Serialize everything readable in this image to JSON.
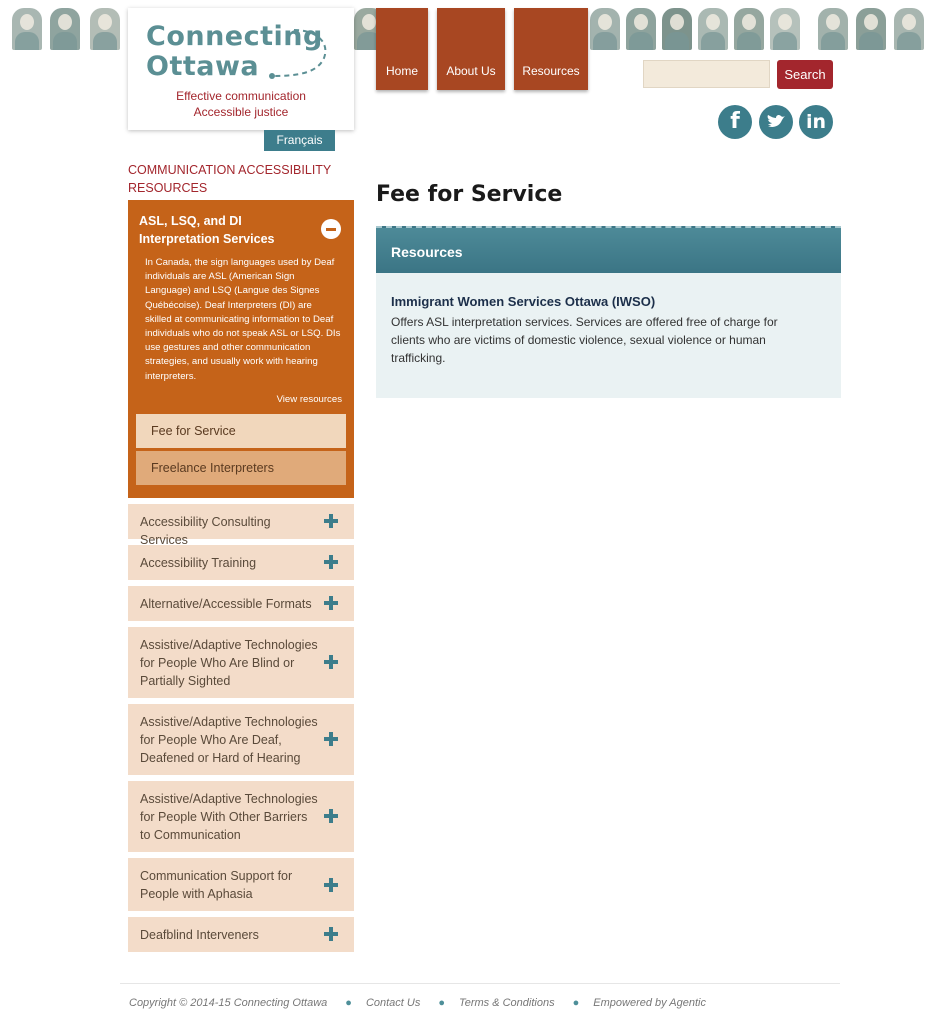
{
  "logo": {
    "title_line1": "Connecting",
    "title_line2": "Ottawa",
    "tagline1": "Effective communication",
    "tagline2": "Accessible justice"
  },
  "lang_toggle": "Français",
  "nav": {
    "home": "Home",
    "about": "About Us",
    "resources": "Resources"
  },
  "search": {
    "placeholder": "",
    "button": "Search"
  },
  "social": {
    "facebook_icon": "facebook-icon",
    "twitter_icon": "twitter-icon",
    "linkedin_icon": "linkedin-icon"
  },
  "sidebar": {
    "heading": "COMMUNICATION ACCESSIBILITY RESOURCES",
    "open_section": {
      "title": "ASL, LSQ, and DI Interpretation Services",
      "description": "In Canada, the sign languages used by Deaf individuals are ASL (American Sign Language) and LSQ (Langue des Signes Québécoise). Deaf Interpreters (DI) are skilled at communicating information to Deaf individuals who do not speak ASL or LSQ. DIs use gestures and other communication strategies, and usually work with hearing interpreters.",
      "view_link": "View resources",
      "sub_items": [
        "Fee for Service",
        "Freelance Interpreters"
      ]
    },
    "items": [
      "Accessibility Consulting Services",
      "Accessibility Training",
      "Alternative/Accessible Formats",
      "Assistive/Adaptive Technologies for People Who Are Blind or Partially Sighted",
      "Assistive/Adaptive Technologies for People Who Are Deaf, Deafened or Hard of Hearing",
      "Assistive/Adaptive Technologies for People With Other Barriers to Communication",
      "Communication Support for People with Aphasia",
      "Deafblind Interveners"
    ]
  },
  "main": {
    "page_title": "Fee for Service",
    "panel_header": "Resources",
    "org_name": "Immigrant Women Services Ottawa (IWSO)",
    "org_desc": "Offers ASL interpretation services. Services are offered free of charge for clients who are victims of domestic violence, sexual violence or human trafficking."
  },
  "footer": {
    "copyright": "Copyright © 2014-15 Connecting Ottawa",
    "contact": "Contact Us",
    "terms": "Terms & Conditions",
    "powered": "Empowered by Agentic"
  },
  "colors": {
    "brand_teal": "#3c7d8b",
    "brand_red": "#a3262d",
    "nav_orange": "#a84722",
    "sidebar_active": "#c56319",
    "sidebar_item_bg": "#f3dcc9"
  }
}
